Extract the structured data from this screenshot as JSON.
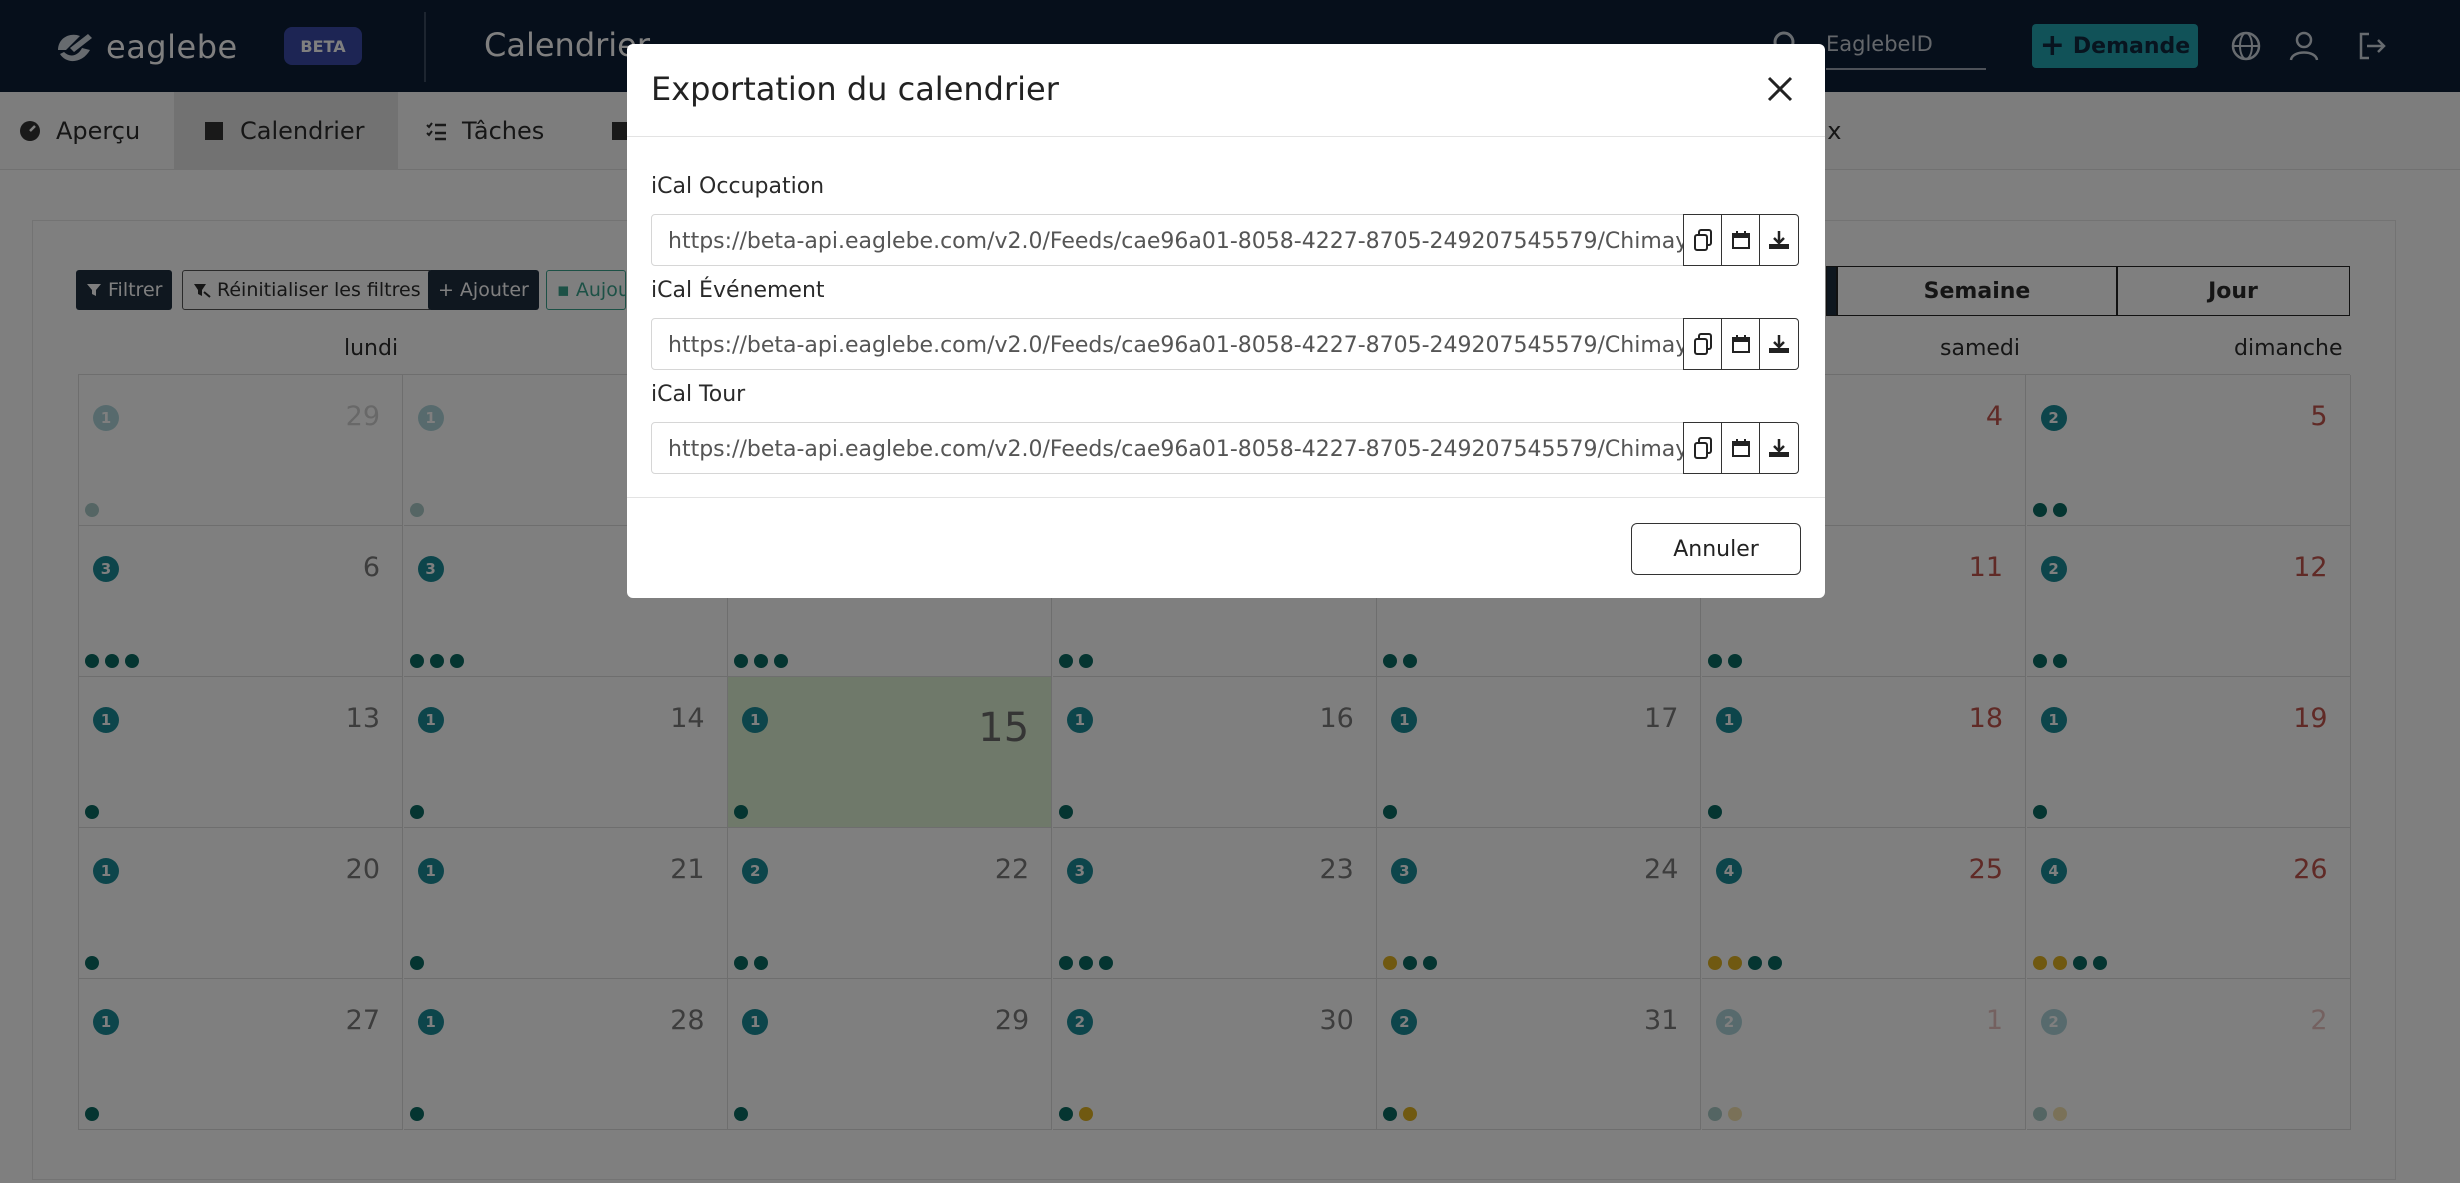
{
  "header": {
    "logo_text": "eaglebe",
    "beta": "BETA",
    "title": "Calendrier",
    "search_placeholder": "EaglebeID",
    "demande_label": "Demande"
  },
  "nav": {
    "items": [
      {
        "label": "Aperçu"
      },
      {
        "label": "Calendrier"
      },
      {
        "label": "Tâches"
      },
      {
        "label": "ux"
      }
    ]
  },
  "toolbar": {
    "filter": "Filtrer",
    "reset": "Réinitialiser les filtres",
    "add": "Ajouter",
    "today": "Aujou"
  },
  "views": {
    "week": "Semaine",
    "day": "Jour"
  },
  "day_headers": {
    "mon": "lundi",
    "sat": "samedi",
    "sun": "dimanche"
  },
  "calendar": {
    "weeks": [
      [
        {
          "d": "29",
          "b": "1",
          "dots": "g"
        },
        {
          "d": "",
          "b": "1",
          "dots": "g"
        },
        {
          "d": "",
          "b": "",
          "dots": ""
        },
        {
          "d": "",
          "b": "",
          "dots": ""
        },
        {
          "d": "",
          "b": "",
          "dots": ""
        },
        {
          "d": "4",
          "b": "",
          "dots": ""
        },
        {
          "d": "5",
          "b": "2",
          "dots": "gg"
        }
      ],
      [
        {
          "d": "6",
          "b": "3",
          "dots": "ggg"
        },
        {
          "d": "",
          "b": "3",
          "dots": "ggg"
        },
        {
          "d": "",
          "b": "",
          "dots": "ggg"
        },
        {
          "d": "",
          "b": "",
          "dots": "gg"
        },
        {
          "d": "",
          "b": "",
          "dots": "gg"
        },
        {
          "d": "11",
          "b": "",
          "dots": "gg"
        },
        {
          "d": "12",
          "b": "2",
          "dots": "gg"
        }
      ],
      [
        {
          "d": "13",
          "b": "1",
          "dots": "g"
        },
        {
          "d": "14",
          "b": "1",
          "dots": "g"
        },
        {
          "d": "15",
          "b": "1",
          "dots": "g"
        },
        {
          "d": "16",
          "b": "1",
          "dots": "g"
        },
        {
          "d": "17",
          "b": "1",
          "dots": "g"
        },
        {
          "d": "18",
          "b": "1",
          "dots": "g"
        },
        {
          "d": "19",
          "b": "1",
          "dots": "g"
        }
      ],
      [
        {
          "d": "20",
          "b": "1",
          "dots": "g"
        },
        {
          "d": "21",
          "b": "1",
          "dots": "g"
        },
        {
          "d": "22",
          "b": "2",
          "dots": "gg"
        },
        {
          "d": "23",
          "b": "3",
          "dots": "ggg"
        },
        {
          "d": "24",
          "b": "3",
          "dots": "ygg"
        },
        {
          "d": "25",
          "b": "4",
          "dots": "yygg"
        },
        {
          "d": "26",
          "b": "4",
          "dots": "yygg"
        }
      ],
      [
        {
          "d": "27",
          "b": "1",
          "dots": "g"
        },
        {
          "d": "28",
          "b": "1",
          "dots": "g"
        },
        {
          "d": "29",
          "b": "1",
          "dots": "g"
        },
        {
          "d": "30",
          "b": "2",
          "dots": "gy"
        },
        {
          "d": "31",
          "b": "2",
          "dots": "gy"
        },
        {
          "d": "1",
          "b": "2",
          "dots": "gy"
        },
        {
          "d": "2",
          "b": "2",
          "dots": "gy"
        }
      ]
    ]
  },
  "modal": {
    "title": "Exportation du calendrier",
    "feeds": [
      {
        "label": "iCal Occupation",
        "url": "https://beta-api.eaglebe.com/v2.0/Feeds/cae96a01-8058-4227-8705-249207545579/Chimay"
      },
      {
        "label": "iCal Événement",
        "url": "https://beta-api.eaglebe.com/v2.0/Feeds/cae96a01-8058-4227-8705-249207545579/Chimay"
      },
      {
        "label": "iCal Tour",
        "url": "https://beta-api.eaglebe.com/v2.0/Feeds/cae96a01-8058-4227-8705-249207545579/Chimay"
      }
    ],
    "cancel": "Annuler"
  }
}
